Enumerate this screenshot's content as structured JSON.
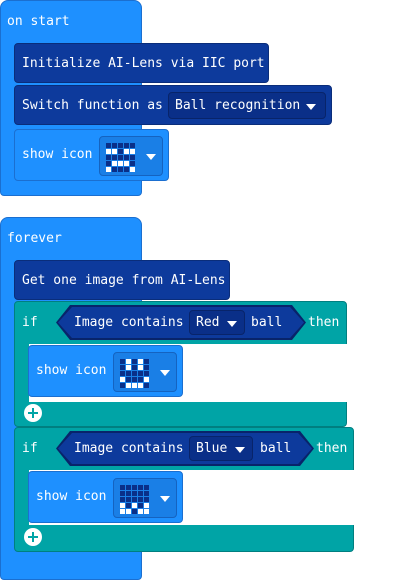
{
  "on_start": {
    "hat_label": "on start",
    "init_label": "Initialize AI-Lens via IIC port",
    "switch_label": "Switch function as",
    "switch_value": "Ball recognition",
    "show_icon_label": "show icon",
    "icon_pattern": [
      [
        0,
        0,
        0,
        0,
        0
      ],
      [
        1,
        1,
        0,
        1,
        1
      ],
      [
        0,
        0,
        0,
        0,
        0
      ],
      [
        0,
        1,
        1,
        1,
        0
      ],
      [
        1,
        0,
        0,
        0,
        1
      ]
    ]
  },
  "forever": {
    "hat_label": "forever",
    "get_image_label": "Get one image from AI-Lens",
    "if_blocks": [
      {
        "if_label": "if",
        "then_label": "then",
        "condition_label": "Image contains",
        "color_value": "Red",
        "ball_label": "ball",
        "show_icon_label": "show icon",
        "icon_pattern": [
          [
            0,
            1,
            0,
            1,
            0
          ],
          [
            0,
            1,
            0,
            1,
            0
          ],
          [
            0,
            0,
            0,
            0,
            0
          ],
          [
            1,
            0,
            0,
            0,
            1
          ],
          [
            0,
            1,
            1,
            1,
            0
          ]
        ]
      },
      {
        "if_label": "if",
        "then_label": "then",
        "condition_label": "Image contains",
        "color_value": "Blue",
        "ball_label": "ball",
        "show_icon_label": "show icon",
        "icon_pattern": [
          [
            0,
            0,
            0,
            0,
            0
          ],
          [
            0,
            0,
            0,
            0,
            0
          ],
          [
            0,
            0,
            0,
            0,
            0
          ],
          [
            1,
            0,
            1,
            0,
            1
          ],
          [
            1,
            1,
            0,
            1,
            1
          ]
        ]
      }
    ]
  },
  "colors": {
    "basic_blue": "#1e90ff",
    "ailens_navy": "#0d3a9c",
    "logic_teal": "#00a4a6",
    "led_on": "#ffffff",
    "led_off": "#0a2f88"
  },
  "icons": {
    "dropdown": "triangle-down",
    "add": "plus-circle"
  }
}
